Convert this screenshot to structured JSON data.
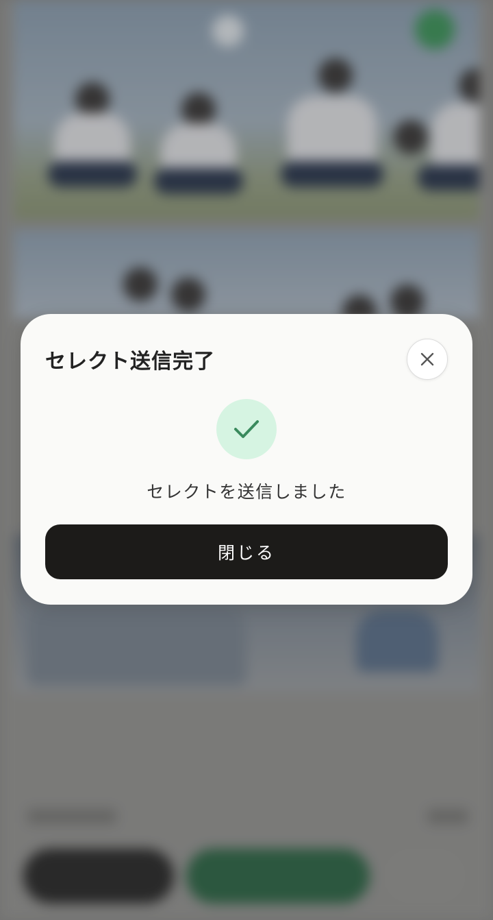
{
  "dialog": {
    "title": "セレクト送信完了",
    "message": "セレクトを送信しました",
    "close_button_label": "閉じる",
    "close_icon": "close-icon",
    "status_icon": "checkmark-icon"
  },
  "colors": {
    "accent_green": "#3f9a5e",
    "check_bg": "#d6f4e2",
    "button_dark": "#1c1b19"
  }
}
